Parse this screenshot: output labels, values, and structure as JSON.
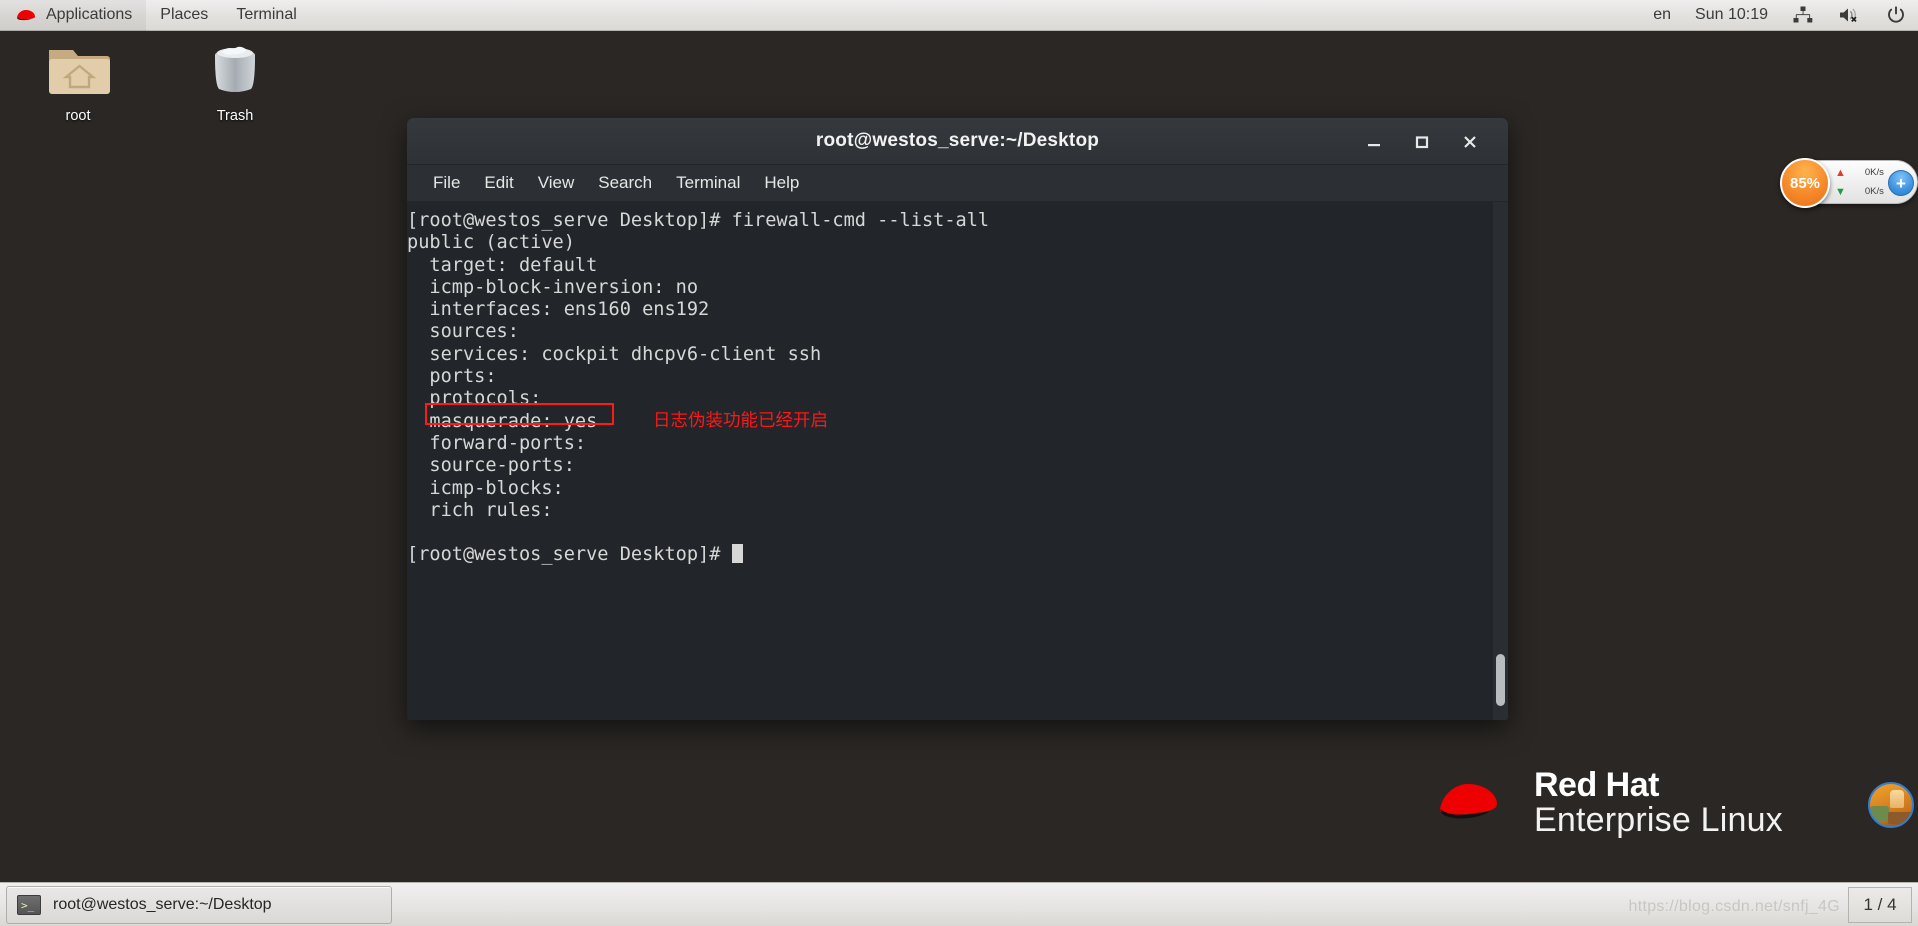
{
  "top_panel": {
    "logo_icon": "redhat-fedora-icon",
    "menus": [
      {
        "label": "Applications",
        "name": "applications-menu"
      },
      {
        "label": "Places",
        "name": "places-menu"
      },
      {
        "label": "Terminal",
        "name": "terminal-menu"
      }
    ],
    "status": {
      "keyboard_layout": "en",
      "clock": "Sun 10:19",
      "network_icon": "network-wired-icon",
      "volume_icon": "volume-muted-icon",
      "power_icon": "power-icon"
    }
  },
  "desktop": {
    "icons": [
      {
        "label": "root",
        "name": "desktop-icon-root",
        "icon": "home-folder-icon"
      },
      {
        "label": "Trash",
        "name": "desktop-icon-trash",
        "icon": "trash-icon"
      }
    ],
    "branding": {
      "line1": "Red Hat",
      "line2": "Enterprise Linux",
      "logo_icon": "redhat-fedora-logo-icon"
    },
    "photo_thumb_icon": "photo-thumbnail-icon"
  },
  "terminal": {
    "title": "root@westos_serve:~/Desktop",
    "window_buttons": {
      "minimize": "minimize-icon",
      "maximize": "maximize-icon",
      "close": "close-icon"
    },
    "menubar": [
      {
        "label": "File",
        "name": "terminal-menu-file"
      },
      {
        "label": "Edit",
        "name": "terminal-menu-edit"
      },
      {
        "label": "View",
        "name": "terminal-menu-view"
      },
      {
        "label": "Search",
        "name": "terminal-menu-search"
      },
      {
        "label": "Terminal",
        "name": "terminal-menu-terminal"
      },
      {
        "label": "Help",
        "name": "terminal-menu-help"
      }
    ],
    "content": "[root@westos_serve Desktop]# firewall-cmd --list-all\npublic (active)\n  target: default\n  icmp-block-inversion: no\n  interfaces: ens160 ens192\n  sources:\n  services: cockpit dhcpv6-client ssh\n  ports:\n  protocols:\n  masquerade: yes\n  forward-ports:\n  source-ports:\n  icmp-blocks:\n  rich rules:\n",
    "prompt_line": "[root@westos_serve Desktop]# ",
    "annotation": {
      "text": "日志伪装功能已经开启",
      "color": "#ff1717",
      "highlight_target": "masquerade: yes",
      "highlight_color": "#ff1a1a"
    }
  },
  "netspeed_widget": {
    "percent": "85%",
    "upload_speed": "0K/s",
    "download_speed": "0K/s",
    "upload_icon": "arrow-up-icon",
    "download_icon": "arrow-down-icon",
    "add_label": "+",
    "accent_color": "#f6892a",
    "add_button_color": "#3d93e0"
  },
  "taskbar": {
    "window_button": {
      "label": "root@westos_serve:~/Desktop",
      "icon": "terminal-icon"
    },
    "workspace_indicator": "1 / 4",
    "watermark": "https://blog.csdn.net/snfj_4G"
  }
}
